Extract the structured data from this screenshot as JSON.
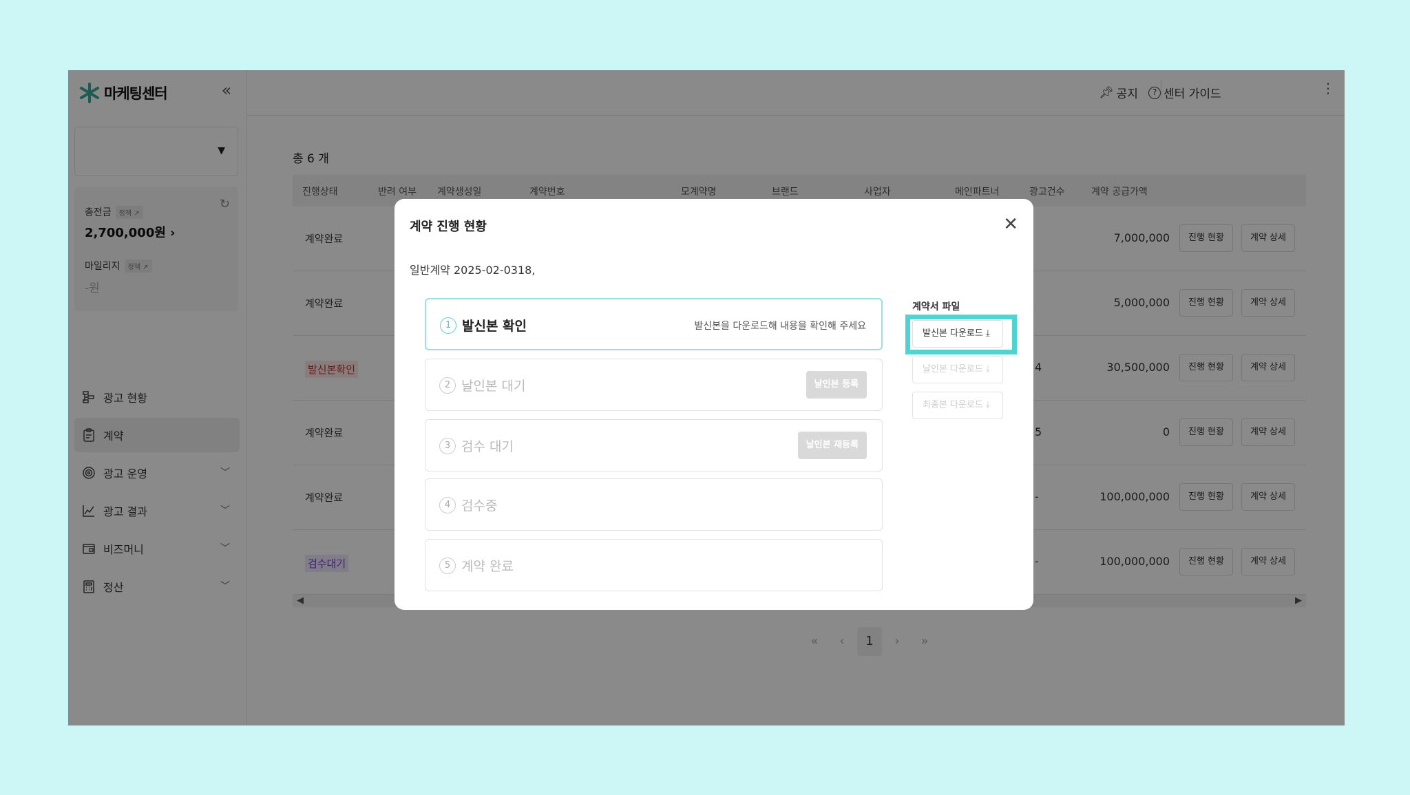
{
  "brand": {
    "name": "마케팅센터"
  },
  "sidebar": {
    "balance": {
      "label": "충전금",
      "tag": "정책 ↗",
      "amount": "2,700,000원 ›"
    },
    "mileage": {
      "label": "마일리지",
      "tag": "정책 ↗",
      "amount": "-원"
    },
    "items": [
      {
        "label": "광고 현황",
        "icon": "flowchart-icon",
        "active": false
      },
      {
        "label": "계약",
        "icon": "clipboard-icon",
        "active": true
      },
      {
        "label": "광고 운영",
        "icon": "target-icon",
        "active": false
      },
      {
        "label": "광고 결과",
        "icon": "line-chart-icon",
        "active": false
      },
      {
        "label": "비즈머니",
        "icon": "wallet-icon",
        "active": false
      },
      {
        "label": "정산",
        "icon": "calculator-icon",
        "active": false
      }
    ]
  },
  "header": {
    "notice": "공지",
    "guide": "센터 가이드"
  },
  "table": {
    "total": "총 6 개",
    "columns": [
      "진행상태",
      "반려 여부",
      "계약생성일",
      "계약번호",
      "모계약명",
      "브랜드",
      "사업자",
      "메인파트너",
      "광고건수",
      "계약 공급가액"
    ],
    "rows": [
      {
        "status": "계약완료",
        "style": "plain",
        "count": "",
        "amount": "7,000,000"
      },
      {
        "status": "계약완료",
        "style": "plain",
        "count": "",
        "amount": "5,000,000"
      },
      {
        "status": "발신본확인",
        "style": "red",
        "count": "4",
        "amount": "30,500,000"
      },
      {
        "status": "계약완료",
        "style": "plain",
        "count": "5",
        "amount": "0"
      },
      {
        "status": "계약완료",
        "style": "plain",
        "count": "-",
        "amount": "100,000,000"
      },
      {
        "status": "검수대기",
        "style": "purple",
        "count": "-",
        "amount": "100,000,000"
      }
    ],
    "progress_btn": "진행 현황",
    "detail_btn": "계약 상세"
  },
  "pagination": {
    "first": "«",
    "prev": "‹",
    "current": "1",
    "next": "›",
    "last": "»"
  },
  "modal": {
    "title": "계약 진행 현황",
    "subtitle": "일반계약 2025-02-0318,",
    "steps": [
      {
        "num": "1",
        "name": "발신본 확인",
        "hint": "발신본을 다운로드해 내용을 확인해 주세요",
        "button": ""
      },
      {
        "num": "2",
        "name": "날인본 대기",
        "hint": "",
        "button": "날인본 등록"
      },
      {
        "num": "3",
        "name": "검수 대기",
        "hint": "",
        "button": "날인본 재등록"
      },
      {
        "num": "4",
        "name": "검수중",
        "hint": "",
        "button": ""
      },
      {
        "num": "5",
        "name": "계약 완료",
        "hint": "",
        "button": ""
      }
    ],
    "files": {
      "label": "계약서 파일",
      "buttons": [
        {
          "label": "발신본 다운로드",
          "enabled": true
        },
        {
          "label": "날인본 다운로드",
          "enabled": false
        },
        {
          "label": "최종본 다운로드",
          "enabled": false
        }
      ]
    }
  },
  "colors": {
    "accent": "#4fd4d4",
    "background": "#cdf6f6",
    "status_red": "#c0392b",
    "status_purple": "#6c3fc9"
  }
}
